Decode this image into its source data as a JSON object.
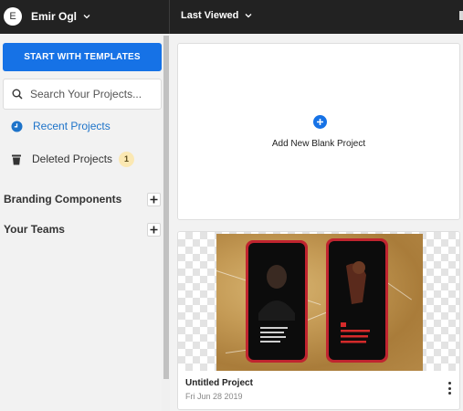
{
  "header": {
    "avatar_initial": "E",
    "user_name": "Emir Ogl",
    "sort_label": "Last Viewed"
  },
  "sidebar": {
    "templates_button": "START WITH TEMPLATES",
    "search_placeholder": "Search Your Projects...",
    "nav": [
      {
        "label": "Recent Projects",
        "icon": "clock-icon"
      },
      {
        "label": "Deleted Projects",
        "icon": "trash-icon",
        "badge": "1"
      }
    ],
    "sections": [
      {
        "title": "Branding Components"
      },
      {
        "title": "Your Teams"
      }
    ]
  },
  "main": {
    "new_project_label": "Add New Blank Project",
    "projects": [
      {
        "title": "Untitled Project",
        "date": "Fri Jun 28 2019"
      }
    ]
  },
  "colors": {
    "accent": "#1672e6",
    "topbar": "#222222",
    "link": "#1d73c9",
    "badge": "#fbe8b3"
  }
}
